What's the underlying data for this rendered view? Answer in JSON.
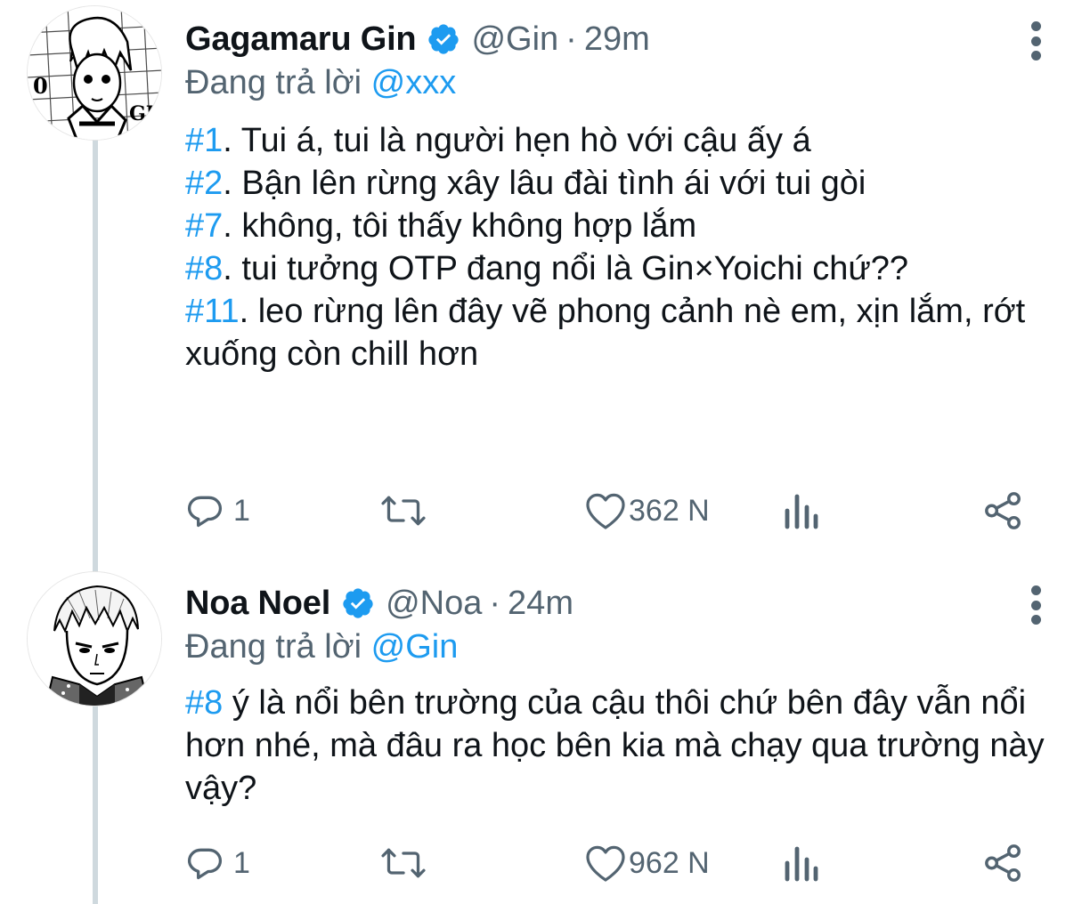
{
  "colors": {
    "accent": "#1d9bf0",
    "secondary_text": "#536471",
    "primary_text": "#0f1419",
    "thread_line": "#cfd9de"
  },
  "tweets": [
    {
      "display_name": "Gagamaru Gin",
      "handle": "@Gin",
      "separator": "·",
      "time": "29m",
      "verified_icon": "verified-badge-icon",
      "reply_prefix": "Đang trả lời",
      "reply_mention": "@xxx",
      "body_lines": [
        {
          "tag": "#1",
          "text": ". Tui á, tui là người hẹn hò với cậu ấy á"
        },
        {
          "tag": "#2",
          "text": ". Bận lên rừng xây lâu đài tình ái với tui gòi"
        },
        {
          "tag": "#7",
          "text": ". không, tôi thấy không hợp lắm"
        },
        {
          "tag": "#8",
          "text": ". tui tưởng OTP đang nổi là Gin×Yoichi chứ??"
        },
        {
          "tag": "#11",
          "text": ". leo rừng lên đây vẽ phong cảnh nè em, xịn lắm, rớt xuống còn chill hơn"
        }
      ],
      "actions": {
        "reply_count": "1",
        "retweet_count": "",
        "like_count": "362 N",
        "views_count": ""
      }
    },
    {
      "display_name": "Noa Noel",
      "handle": "@Noa",
      "separator": "·",
      "time": "24m",
      "verified_icon": "verified-badge-icon",
      "reply_prefix": "Đang trả lời",
      "reply_mention": "@Gin",
      "body_tag": "#8",
      "body_text": " ý là nổi bên trường của cậu thôi chứ bên đây vẫn nổi hơn nhé, mà đâu ra học bên kia mà chạy qua trường này vậy?",
      "actions": {
        "reply_count": "1",
        "retweet_count": "",
        "like_count": "962 N",
        "views_count": ""
      }
    }
  ]
}
